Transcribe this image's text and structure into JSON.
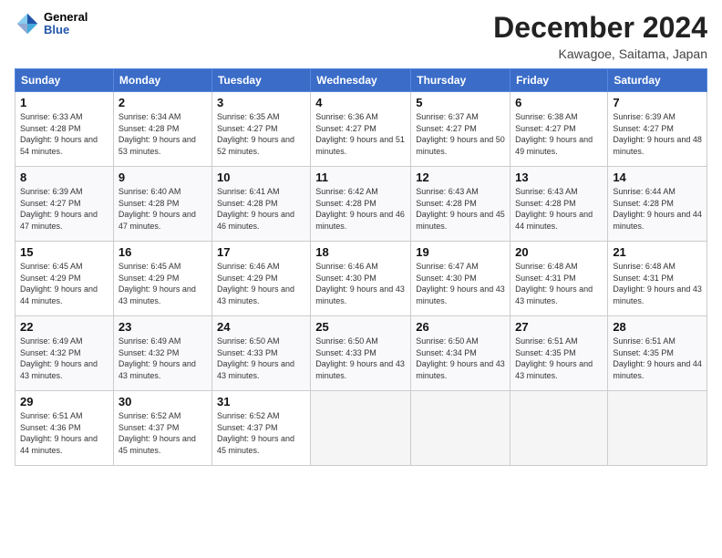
{
  "header": {
    "logo_general": "General",
    "logo_blue": "Blue",
    "month_title": "December 2024",
    "location": "Kawagoe, Saitama, Japan"
  },
  "weekdays": [
    "Sunday",
    "Monday",
    "Tuesday",
    "Wednesday",
    "Thursday",
    "Friday",
    "Saturday"
  ],
  "weeks": [
    [
      {
        "day": 1,
        "sunrise": "6:33 AM",
        "sunset": "4:28 PM",
        "daylight": "9 hours and 54 minutes."
      },
      {
        "day": 2,
        "sunrise": "6:34 AM",
        "sunset": "4:28 PM",
        "daylight": "9 hours and 53 minutes."
      },
      {
        "day": 3,
        "sunrise": "6:35 AM",
        "sunset": "4:27 PM",
        "daylight": "9 hours and 52 minutes."
      },
      {
        "day": 4,
        "sunrise": "6:36 AM",
        "sunset": "4:27 PM",
        "daylight": "9 hours and 51 minutes."
      },
      {
        "day": 5,
        "sunrise": "6:37 AM",
        "sunset": "4:27 PM",
        "daylight": "9 hours and 50 minutes."
      },
      {
        "day": 6,
        "sunrise": "6:38 AM",
        "sunset": "4:27 PM",
        "daylight": "9 hours and 49 minutes."
      },
      {
        "day": 7,
        "sunrise": "6:39 AM",
        "sunset": "4:27 PM",
        "daylight": "9 hours and 48 minutes."
      }
    ],
    [
      {
        "day": 8,
        "sunrise": "6:39 AM",
        "sunset": "4:27 PM",
        "daylight": "9 hours and 47 minutes."
      },
      {
        "day": 9,
        "sunrise": "6:40 AM",
        "sunset": "4:28 PM",
        "daylight": "9 hours and 47 minutes."
      },
      {
        "day": 10,
        "sunrise": "6:41 AM",
        "sunset": "4:28 PM",
        "daylight": "9 hours and 46 minutes."
      },
      {
        "day": 11,
        "sunrise": "6:42 AM",
        "sunset": "4:28 PM",
        "daylight": "9 hours and 46 minutes."
      },
      {
        "day": 12,
        "sunrise": "6:43 AM",
        "sunset": "4:28 PM",
        "daylight": "9 hours and 45 minutes."
      },
      {
        "day": 13,
        "sunrise": "6:43 AM",
        "sunset": "4:28 PM",
        "daylight": "9 hours and 44 minutes."
      },
      {
        "day": 14,
        "sunrise": "6:44 AM",
        "sunset": "4:28 PM",
        "daylight": "9 hours and 44 minutes."
      }
    ],
    [
      {
        "day": 15,
        "sunrise": "6:45 AM",
        "sunset": "4:29 PM",
        "daylight": "9 hours and 44 minutes."
      },
      {
        "day": 16,
        "sunrise": "6:45 AM",
        "sunset": "4:29 PM",
        "daylight": "9 hours and 43 minutes."
      },
      {
        "day": 17,
        "sunrise": "6:46 AM",
        "sunset": "4:29 PM",
        "daylight": "9 hours and 43 minutes."
      },
      {
        "day": 18,
        "sunrise": "6:46 AM",
        "sunset": "4:30 PM",
        "daylight": "9 hours and 43 minutes."
      },
      {
        "day": 19,
        "sunrise": "6:47 AM",
        "sunset": "4:30 PM",
        "daylight": "9 hours and 43 minutes."
      },
      {
        "day": 20,
        "sunrise": "6:48 AM",
        "sunset": "4:31 PM",
        "daylight": "9 hours and 43 minutes."
      },
      {
        "day": 21,
        "sunrise": "6:48 AM",
        "sunset": "4:31 PM",
        "daylight": "9 hours and 43 minutes."
      }
    ],
    [
      {
        "day": 22,
        "sunrise": "6:49 AM",
        "sunset": "4:32 PM",
        "daylight": "9 hours and 43 minutes."
      },
      {
        "day": 23,
        "sunrise": "6:49 AM",
        "sunset": "4:32 PM",
        "daylight": "9 hours and 43 minutes."
      },
      {
        "day": 24,
        "sunrise": "6:50 AM",
        "sunset": "4:33 PM",
        "daylight": "9 hours and 43 minutes."
      },
      {
        "day": 25,
        "sunrise": "6:50 AM",
        "sunset": "4:33 PM",
        "daylight": "9 hours and 43 minutes."
      },
      {
        "day": 26,
        "sunrise": "6:50 AM",
        "sunset": "4:34 PM",
        "daylight": "9 hours and 43 minutes."
      },
      {
        "day": 27,
        "sunrise": "6:51 AM",
        "sunset": "4:35 PM",
        "daylight": "9 hours and 43 minutes."
      },
      {
        "day": 28,
        "sunrise": "6:51 AM",
        "sunset": "4:35 PM",
        "daylight": "9 hours and 44 minutes."
      }
    ],
    [
      {
        "day": 29,
        "sunrise": "6:51 AM",
        "sunset": "4:36 PM",
        "daylight": "9 hours and 44 minutes."
      },
      {
        "day": 30,
        "sunrise": "6:52 AM",
        "sunset": "4:37 PM",
        "daylight": "9 hours and 45 minutes."
      },
      {
        "day": 31,
        "sunrise": "6:52 AM",
        "sunset": "4:37 PM",
        "daylight": "9 hours and 45 minutes."
      },
      null,
      null,
      null,
      null
    ]
  ]
}
